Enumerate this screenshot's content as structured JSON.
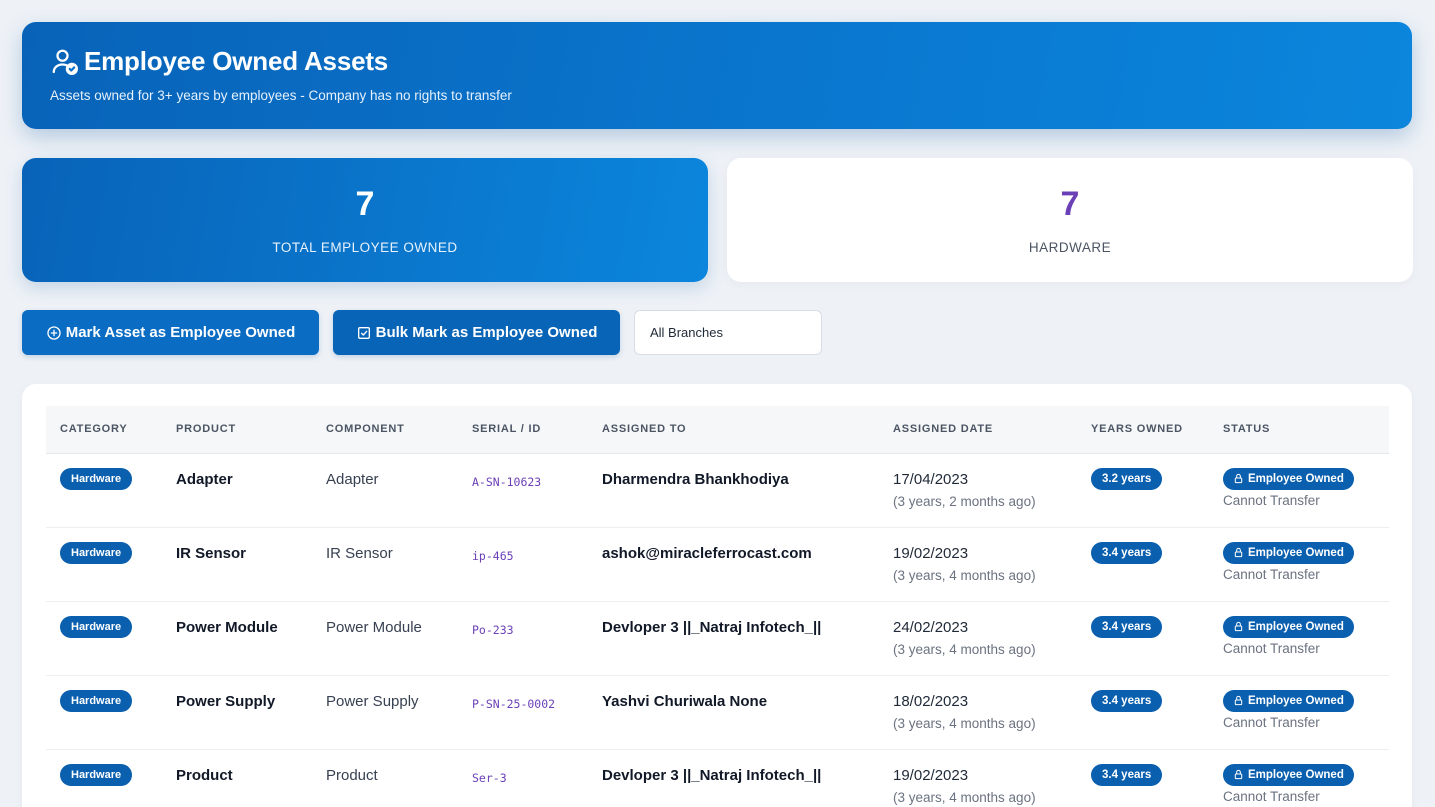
{
  "header": {
    "title": "Employee Owned Assets",
    "subtitle": "Assets owned for 3+ years by employees - Company has no rights to transfer",
    "icon": "user-check-icon"
  },
  "stats": [
    {
      "value": "7",
      "label": "TOTAL EMPLOYEE OWNED"
    },
    {
      "value": "7",
      "label": "HARDWARE"
    }
  ],
  "actions": {
    "mark_label": "Mark Asset as Employee Owned",
    "bulk_label": "Bulk Mark as Employee Owned",
    "branch_select": "All Branches"
  },
  "table": {
    "columns": [
      "CATEGORY",
      "PRODUCT",
      "COMPONENT",
      "SERIAL / ID",
      "ASSIGNED TO",
      "ASSIGNED DATE",
      "YEARS OWNED",
      "STATUS"
    ],
    "rows": [
      {
        "category": "Hardware",
        "product": "Adapter",
        "component": "Adapter",
        "serial": "A-SN-10623",
        "assigned_to": "Dharmendra Bhankhodiya",
        "date": "17/04/2023",
        "ago": "(3 years, 2 months ago)",
        "years": "3.2 years",
        "status": "Employee Owned",
        "note": "Cannot Transfer"
      },
      {
        "category": "Hardware",
        "product": "IR Sensor",
        "component": "IR Sensor",
        "serial": "ip-465",
        "assigned_to": "ashok@miracleferrocast.com",
        "date": "19/02/2023",
        "ago": "(3 years, 4 months ago)",
        "years": "3.4 years",
        "status": "Employee Owned",
        "note": "Cannot Transfer"
      },
      {
        "category": "Hardware",
        "product": "Power Module",
        "component": "Power Module",
        "serial": "Po-233",
        "assigned_to": "Devloper 3 ||_Natraj Infotech_||",
        "date": "24/02/2023",
        "ago": "(3 years, 4 months ago)",
        "years": "3.4 years",
        "status": "Employee Owned",
        "note": "Cannot Transfer"
      },
      {
        "category": "Hardware",
        "product": "Power Supply",
        "component": "Power Supply",
        "serial": "P-SN-25-0002",
        "assigned_to": "Yashvi Churiwala None",
        "date": "18/02/2023",
        "ago": "(3 years, 4 months ago)",
        "years": "3.4 years",
        "status": "Employee Owned",
        "note": "Cannot Transfer"
      },
      {
        "category": "Hardware",
        "product": "Product",
        "component": "Product",
        "serial": "Ser-3",
        "assigned_to": "Devloper 3 ||_Natraj Infotech_||",
        "date": "19/02/2023",
        "ago": "(3 years, 4 months ago)",
        "years": "3.4 years",
        "status": "Employee Owned",
        "note": "Cannot Transfer"
      }
    ]
  }
}
